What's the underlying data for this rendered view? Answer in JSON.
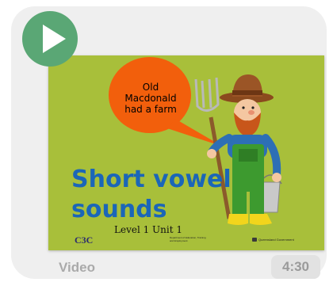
{
  "slide": {
    "speech_bubble": [
      "Old",
      "Macdonald",
      "had a farm"
    ],
    "title_line1": "Short vowel",
    "title_line2": "sounds",
    "subtitle": "Level 1 Unit 1",
    "logo_text": "C3C",
    "department_text": "Department of Education, Training and Employment",
    "government_text": "Queensland Government"
  },
  "card": {
    "type_label": "Video",
    "duration": "4:30"
  },
  "icons": {
    "play": "play-icon"
  },
  "colors": {
    "play_button": "#5aa775",
    "slide_background": "#a8bf3a",
    "headline": "#1b66b8",
    "bubble": "#f25f0c"
  }
}
